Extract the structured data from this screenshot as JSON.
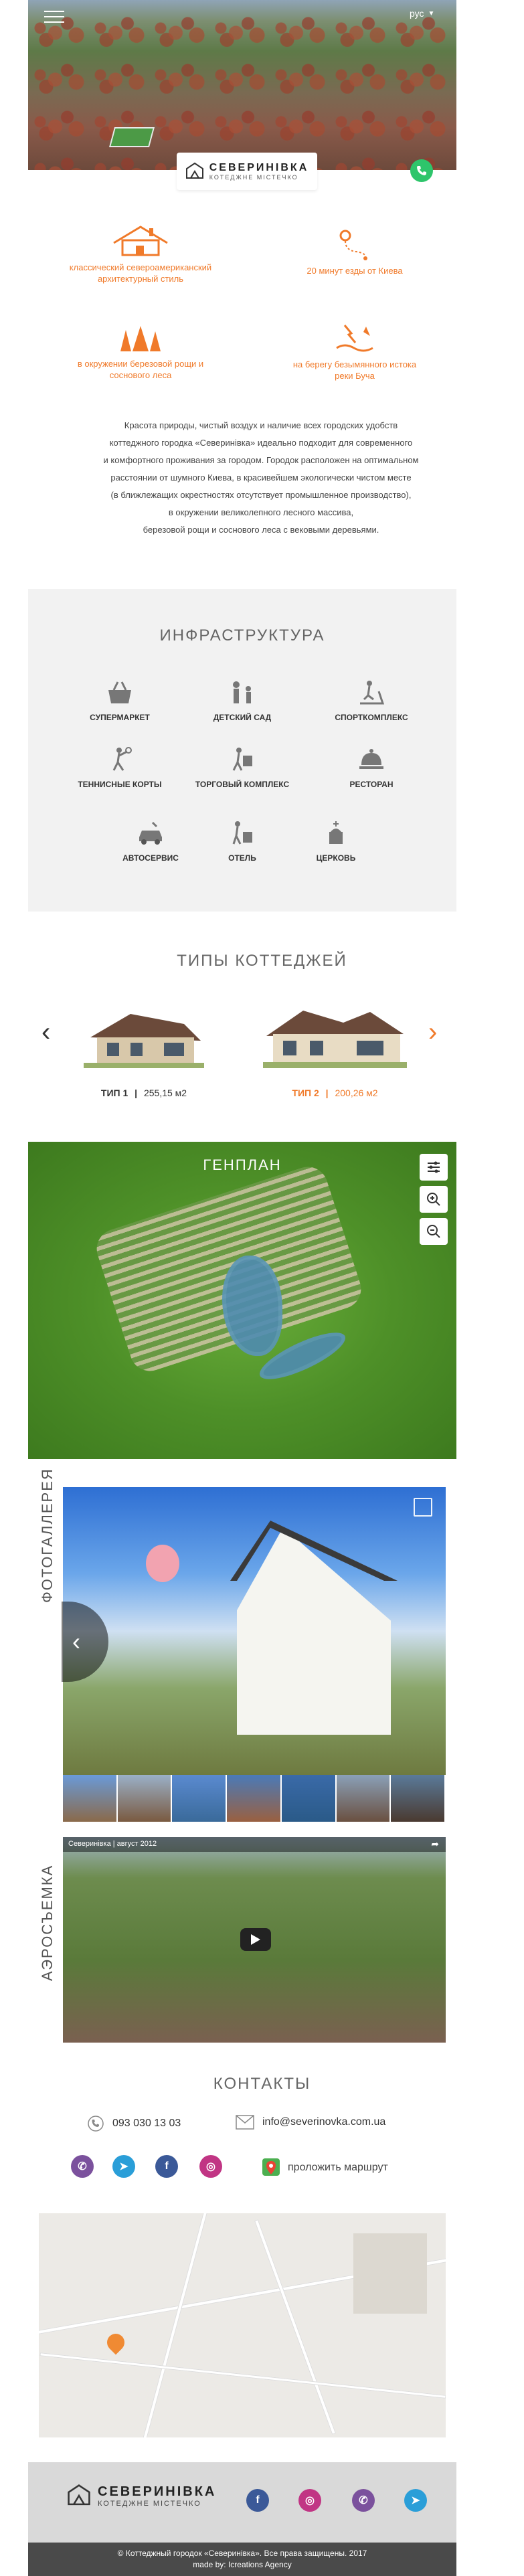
{
  "header": {
    "lang": "рус",
    "logo_title": "СЕВЕРИНІВКА",
    "logo_subtitle": "КОТЕДЖНЕ МІСТЕЧКО"
  },
  "features": [
    {
      "text": "классический североамериканский архитектурный стиль",
      "icon": "house-icon"
    },
    {
      "text": "20 минут езды от Киева",
      "icon": "route-icon"
    },
    {
      "text": "в окружении березовой рощи и соснового леса",
      "icon": "trees-icon"
    },
    {
      "text": "на берегу безымянного истока реки Буча",
      "icon": "river-icon"
    }
  ],
  "about": [
    "Красота природы, чистый воздух и наличие всех городских удобств",
    "коттеджного городка «Северинівка» идеально подходит для современного",
    "и комфортного проживания за городом. Городок расположен на оптимальном",
    "расстоянии от шумного Киева, в красивейшем экологически чистом месте",
    "(в ближлежащих окрестностях отсутствует промышленное производство),",
    "в окружении великолепного лесного массива,",
    "березовой рощи и соснового леса с вековыми деревьями."
  ],
  "infra": {
    "title": "ИНФРАСТРУКТУРА",
    "items": [
      {
        "label": "СУПЕРМАРКЕТ",
        "icon": "basket-icon"
      },
      {
        "label": "ДЕТСКИЙ САД",
        "icon": "kids-icon"
      },
      {
        "label": "СПОРТКОМПЛЕКС",
        "icon": "treadmill-icon"
      },
      {
        "label": "ТЕННИСНЫЕ КОРТЫ",
        "icon": "tennis-icon"
      },
      {
        "label": "ТОРГОВЫЙ КОМПЛЕКС",
        "icon": "shopping-icon"
      },
      {
        "label": "РЕСТОРАН",
        "icon": "cloche-icon"
      },
      {
        "label": "АВТОСЕРВИС",
        "icon": "car-service-icon"
      },
      {
        "label": "ОТЕЛЬ",
        "icon": "hotel-icon"
      },
      {
        "label": "ЦЕРКОВЬ",
        "icon": "church-icon"
      }
    ]
  },
  "cottages": {
    "title": "ТИПЫ КОТТЕДЖЕЙ",
    "items": [
      {
        "type": "ТИП 1",
        "sep": "|",
        "area": "255,15 м2"
      },
      {
        "type": "ТИП 2",
        "sep": "|",
        "area": "200,26 м2"
      }
    ]
  },
  "genplan": {
    "title": "ГЕНПЛАН"
  },
  "gallery": {
    "label": "ФОТОГАЛЛЕРЕЯ"
  },
  "aerial": {
    "label": "АЭРОСЪЕМКА",
    "video_title": "Северинівка | август 2012"
  },
  "contacts": {
    "title": "КОНТАКТЫ",
    "phone": "093 030 13 03",
    "email": "info@severinovka.com.ua",
    "route": "проложить маршрут"
  },
  "footer": {
    "logo_title": "СЕВЕРИНІВКА",
    "logo_subtitle": "КОТЕДЖНЕ МІСТЕЧКО",
    "copyright": "© Коттеджный городок «Северинівка». Все права защищены. 2017",
    "made_by": "made by: Icreations Agency"
  },
  "colors": {
    "accent": "#f07a2a",
    "green": "#2ec56b"
  }
}
